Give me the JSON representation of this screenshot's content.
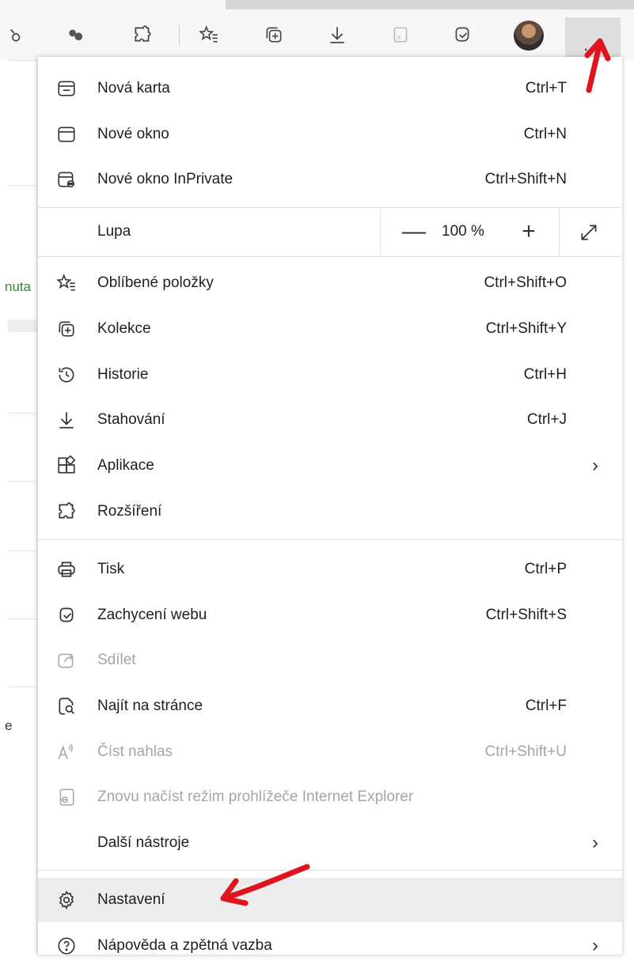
{
  "page_background": {
    "partial_text_1": "nuta",
    "partial_text_2": "e"
  },
  "toolbar": {
    "icons": [
      "extension-puzzle-icon",
      "favorites-icon",
      "collections-icon",
      "downloads-icon",
      "ie-mode-icon",
      "web-capture-icon",
      "profile-avatar",
      "more-options-icon"
    ],
    "more_label": "···"
  },
  "menu": {
    "items": [
      {
        "label": "Nová karta",
        "shortcut": "Ctrl+T",
        "icon": "new-tab-icon"
      },
      {
        "label": "Nové okno",
        "shortcut": "Ctrl+N",
        "icon": "new-window-icon"
      },
      {
        "label": "Nové okno InPrivate",
        "shortcut": "Ctrl+Shift+N",
        "icon": "inprivate-icon"
      },
      {
        "label": "Oblíbené položky",
        "shortcut": "Ctrl+Shift+O",
        "icon": "favorites-icon"
      },
      {
        "label": "Kolekce",
        "shortcut": "Ctrl+Shift+Y",
        "icon": "collections-icon"
      },
      {
        "label": "Historie",
        "shortcut": "Ctrl+H",
        "icon": "history-icon"
      },
      {
        "label": "Stahování",
        "shortcut": "Ctrl+J",
        "icon": "download-icon"
      },
      {
        "label": "Aplikace",
        "shortcut": "",
        "icon": "apps-icon",
        "submenu": true
      },
      {
        "label": "Rozšíření",
        "shortcut": "",
        "icon": "extensions-icon"
      },
      {
        "label": "Tisk",
        "shortcut": "Ctrl+P",
        "icon": "print-icon"
      },
      {
        "label": "Zachycení webu",
        "shortcut": "Ctrl+Shift+S",
        "icon": "web-capture-icon"
      },
      {
        "label": "Sdílet",
        "shortcut": "",
        "icon": "share-icon",
        "disabled": true
      },
      {
        "label": "Najít na stránce",
        "shortcut": "Ctrl+F",
        "icon": "find-icon"
      },
      {
        "label": "Číst nahlas",
        "shortcut": "Ctrl+Shift+U",
        "icon": "read-aloud-icon",
        "disabled": true
      },
      {
        "label": "Znovu načíst režim prohlížeče Internet Explorer",
        "shortcut": "",
        "icon": "ie-reload-icon",
        "disabled": true
      },
      {
        "label": "Další nástroje",
        "shortcut": "",
        "icon": "",
        "submenu": true
      },
      {
        "label": "Nastavení",
        "shortcut": "",
        "icon": "settings-icon",
        "hover": true
      },
      {
        "label": "Nápověda a zpětná vazba",
        "shortcut": "",
        "icon": "help-icon",
        "submenu": true
      }
    ],
    "zoom": {
      "label": "Lupa",
      "value": "100 %",
      "minus": "—",
      "plus": "+"
    },
    "chevron": "›"
  },
  "colors": {
    "annotation_arrow": "#e0141e",
    "hover_row": "#ededed",
    "disabled_text": "#a5a5a5"
  }
}
